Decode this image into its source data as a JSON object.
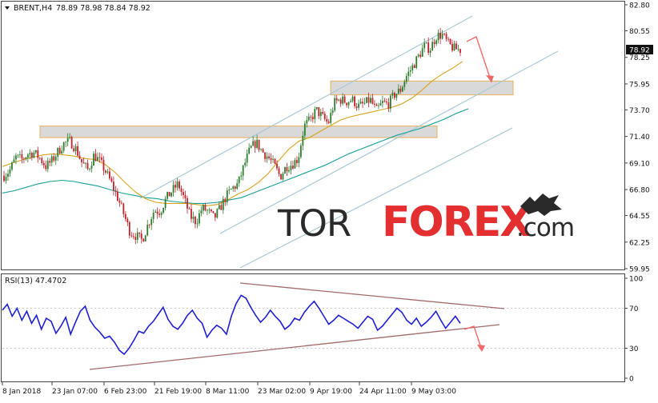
{
  "chart_data": [
    {
      "type": "candlestick",
      "header": {
        "symbol_label": "BRENT,H4",
        "ohlc_text": "78.89 78.98 78.84 78.92"
      },
      "current_price": 78.92,
      "ylim": [
        59.95,
        82.8
      ],
      "y_ticks": [
        "82.80",
        "80.55",
        "78.25",
        "75.95",
        "73.70",
        "71.40",
        "69.10",
        "66.80",
        "64.55",
        "62.25",
        "59.95"
      ],
      "x_ticks": [
        "8 Jan 2018",
        "23 Jan 07:00",
        "6 Feb 23:00",
        "21 Feb 19:00",
        "8 Mar 11:00",
        "23 Mar 02:00",
        "9 Apr 19:00",
        "24 Apr 11:00",
        "9 May 03:00"
      ],
      "grid": false,
      "legend": "none",
      "colors": {
        "bull_candle": "#2d7d2d",
        "bear_candle": "#c0202a",
        "ma_short": "#d8a21c",
        "ma_long": "#17a19a",
        "channel": "#a9c8d6",
        "zone_fill": "#d9d9d9",
        "zone_border": "#e7b15a",
        "arrow": "#f26a6a",
        "brand_dark": "#2a2a2a",
        "brand_accent": "#e32f2f"
      },
      "series": [
        {
          "values": [
            68.0,
            68.5,
            69.6,
            69.4,
            69.9,
            70.0,
            69.5,
            68.8,
            69.3,
            70.1,
            70.8,
            71.0,
            70.3,
            69.1,
            68.5,
            69.8,
            69.2,
            68.3,
            67.2,
            66.0,
            64.6,
            63.1,
            62.8,
            62.4,
            63.8,
            65.0,
            64.9,
            66.0,
            66.7,
            67.3,
            66.0,
            64.5,
            64.0,
            65.2,
            64.9,
            64.3,
            65.2,
            66.2,
            66.9,
            67.3,
            68.9,
            70.3,
            70.9,
            70.1,
            69.6,
            68.9,
            67.9,
            68.8,
            69.0,
            69.5,
            72.3,
            72.8,
            73.7,
            73.1,
            72.5,
            74.3,
            74.6,
            74.4,
            74.6,
            74.0,
            74.2,
            74.6,
            73.6,
            74.3,
            74.2,
            75.0,
            75.4,
            76.6,
            77.4,
            78.3,
            79.2,
            79.0,
            80.1,
            80.2,
            79.4,
            79.0,
            78.9
          ]
        },
        {
          "name": "",
          "values": [
            68.8,
            69.1,
            69.4,
            69.6,
            69.8,
            69.9,
            69.8,
            69.7,
            69.5,
            69.4,
            69.0,
            68.3,
            67.4,
            66.6,
            66.0,
            65.7,
            65.6,
            65.6,
            65.6,
            65.5,
            65.4,
            65.5,
            65.9,
            66.4,
            66.8,
            67.4,
            68.2,
            69.3,
            70.3,
            71.0,
            71.3,
            71.8,
            72.3,
            72.8,
            73.1,
            73.3,
            73.5,
            73.7,
            73.9,
            74.2,
            74.7,
            75.4,
            76.2,
            76.8,
            77.3,
            77.9
          ]
        },
        {
          "name": "",
          "values": [
            66.5,
            66.7,
            67.0,
            67.3,
            67.5,
            67.6,
            67.5,
            67.3,
            67.1,
            66.8,
            66.5,
            66.3,
            66.1,
            66.0,
            65.8,
            65.7,
            65.6,
            65.6,
            65.7,
            65.9,
            66.1,
            66.5,
            66.9,
            67.3,
            67.7,
            68.1,
            68.5,
            68.9,
            69.4,
            69.9,
            70.3,
            70.7,
            71.1,
            71.5,
            71.8,
            72.1,
            72.5,
            72.9,
            73.4,
            73.8
          ]
        }
      ],
      "resistance_zones": [
        {
          "from": 71.3,
          "to": 72.3
        },
        {
          "from": 75.0,
          "to": 76.2
        }
      ],
      "ascending_channel_lines": 3,
      "forecast_arrow": "down",
      "watermark": {
        "part_dark": "TOR",
        "part_accent": "FOREX",
        "part_suffix": ".com"
      }
    },
    {
      "type": "line",
      "indicator": "RSI(13)",
      "header_text": "RSI(13) 47.4702",
      "ylim": [
        0,
        100
      ],
      "y_ticks": [
        "100",
        "70",
        "30",
        "0"
      ],
      "levels": [
        70,
        30
      ],
      "line_color": "#1f1fd6",
      "values": [
        68,
        74,
        62,
        70,
        58,
        67,
        55,
        63,
        49,
        60,
        57,
        45,
        52,
        61,
        44,
        56,
        67,
        72,
        58,
        51,
        46,
        40,
        42,
        36,
        28,
        24,
        30,
        38,
        47,
        45,
        52,
        57,
        64,
        71,
        59,
        52,
        49,
        55,
        63,
        68,
        60,
        55,
        41,
        48,
        53,
        50,
        44,
        62,
        75,
        83,
        80,
        71,
        63,
        56,
        61,
        68,
        62,
        57,
        49,
        53,
        60,
        58,
        66,
        72,
        77,
        70,
        62,
        54,
        58,
        63,
        60,
        57,
        54,
        50,
        56,
        62,
        59,
        48,
        52,
        58,
        64,
        70,
        66,
        58,
        54,
        60,
        52,
        56,
        61,
        67,
        58,
        50,
        56,
        62,
        55
      ],
      "trend_lines": "converging_triangle",
      "forecast_arrow": "down"
    }
  ]
}
